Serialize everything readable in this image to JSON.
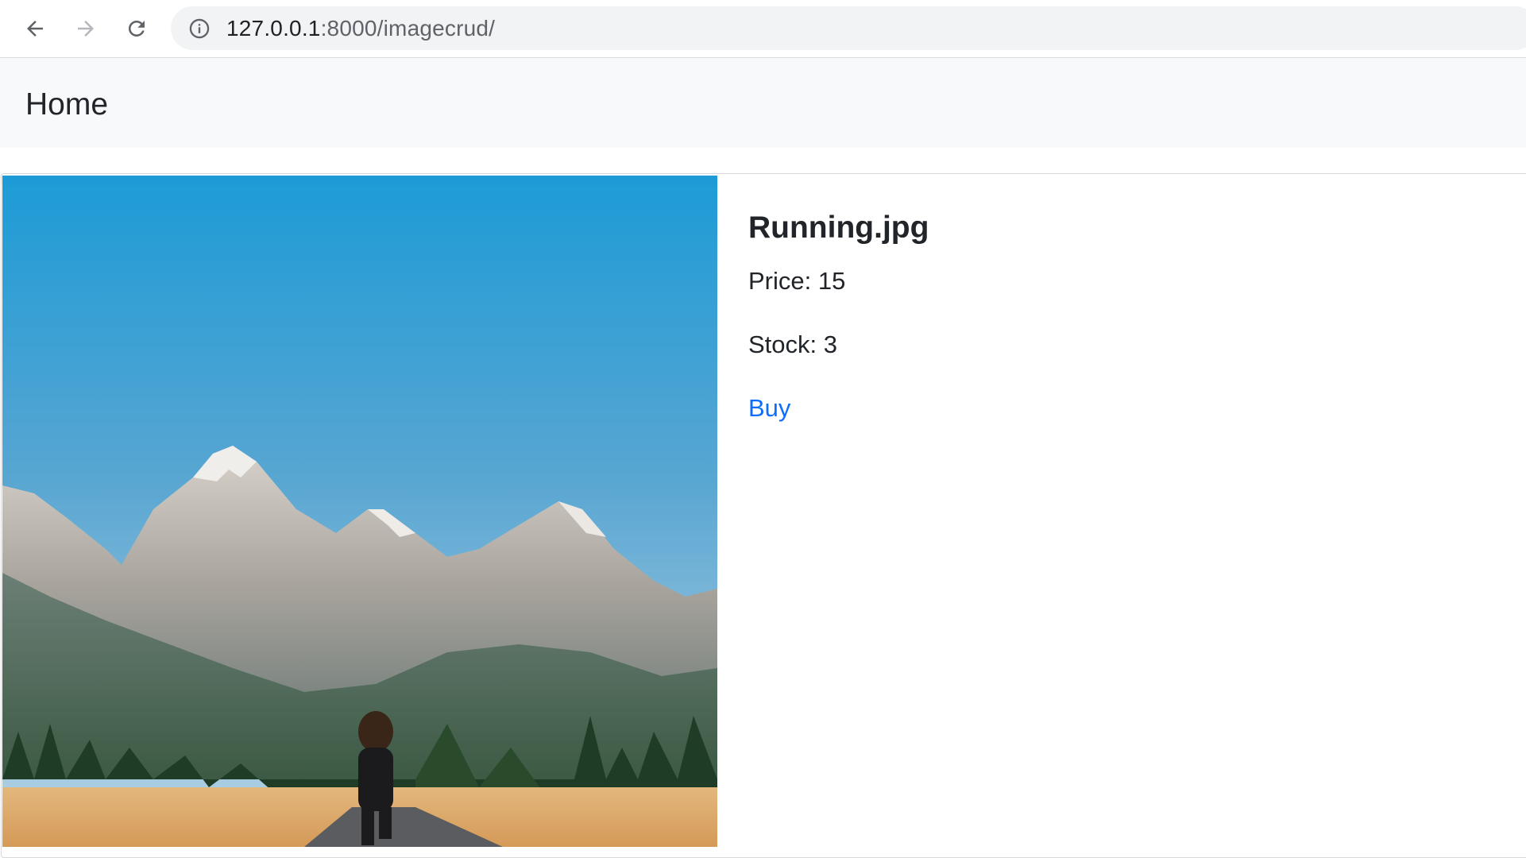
{
  "browser": {
    "url_host": "127.0.0.1",
    "url_path": ":8000/imagecrud/",
    "icons": [
      "back-arrow-icon",
      "forward-arrow-icon",
      "reload-icon",
      "info-icon"
    ]
  },
  "navbar": {
    "brand": "Home"
  },
  "product": {
    "title": "Running.jpg",
    "price_text": "Price: 15",
    "stock_text": "Stock: 3",
    "buy_label": "Buy"
  },
  "colors": {
    "link": "#0d6efd",
    "navbar_bg": "#f8f9fa",
    "omnibox_bg": "#f1f3f4"
  }
}
